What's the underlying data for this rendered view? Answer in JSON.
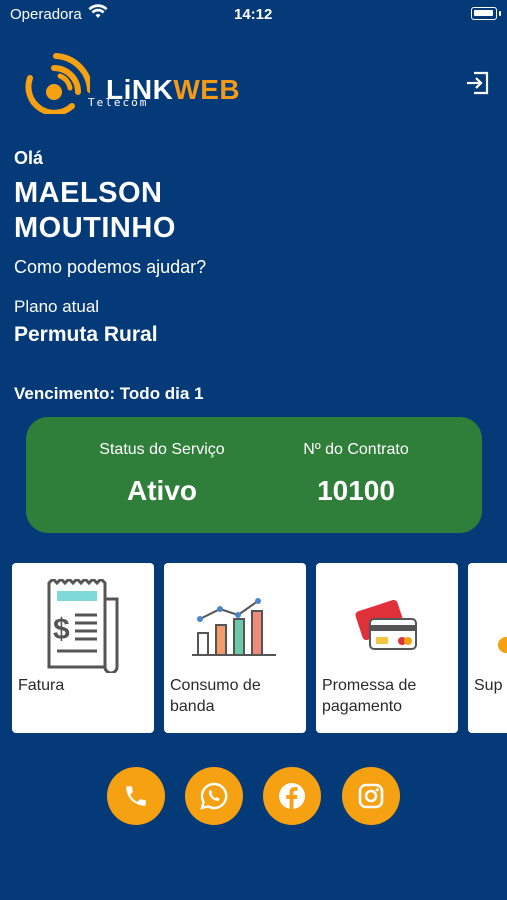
{
  "status_bar": {
    "carrier": "Operadora",
    "time": "14:12"
  },
  "logo": {
    "brand_link": "LiNK",
    "brand_web": "WEB",
    "subtitle": "Telecom"
  },
  "header": {
    "logout_icon": "logout-icon"
  },
  "greeting": {
    "hello": "Olá",
    "name_line1": "MAELSON",
    "name_line2": "MOUTINHO",
    "help": "Como podemos ajudar?"
  },
  "plan": {
    "label": "Plano atual",
    "name": "Permuta Rural",
    "due": "Vencimento: Todo dia 1"
  },
  "service": {
    "status_label": "Status do Serviço",
    "status_value": "Ativo",
    "contract_label": "Nº do Contrato",
    "contract_value": "10100"
  },
  "tiles": [
    {
      "label": "Fatura",
      "icon": "invoice-icon"
    },
    {
      "label": "Consumo de banda",
      "icon": "bandwidth-chart-icon"
    },
    {
      "label": "Promessa de pagamento",
      "icon": "credit-card-icon"
    },
    {
      "label": "Sup",
      "icon": "support-icon"
    }
  ],
  "social": [
    {
      "name": "phone-icon"
    },
    {
      "name": "whatsapp-icon"
    },
    {
      "name": "facebook-icon"
    },
    {
      "name": "instagram-icon"
    }
  ],
  "colors": {
    "background": "#053a78",
    "accent": "#f5a112",
    "status_card": "#2f7f3b",
    "tile": "#ffffff"
  }
}
